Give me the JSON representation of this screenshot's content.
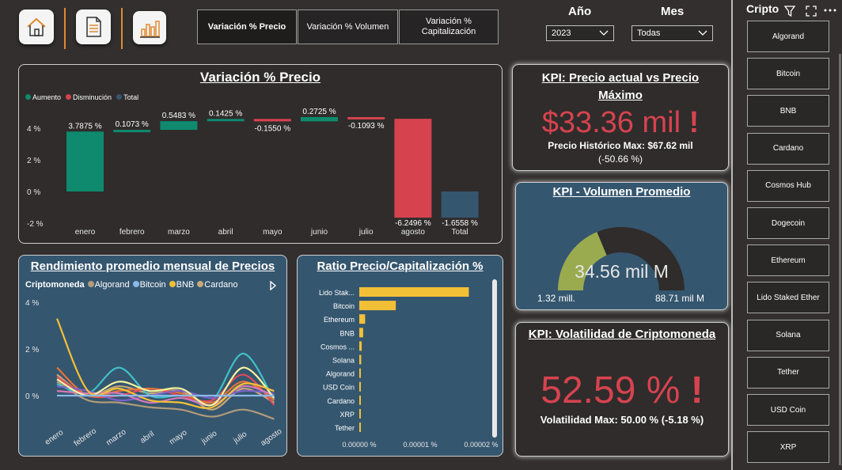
{
  "nav": {
    "home_icon": "home-icon",
    "report_icon": "document-icon",
    "chart_icon": "bar-chart-icon",
    "tabs": [
      {
        "label": "Variación % Precio"
      },
      {
        "label": "Variación % Volumen"
      },
      {
        "label": "Variación % Capitalización"
      }
    ]
  },
  "filters": {
    "year_label": "Año",
    "year_value": "2023",
    "month_label": "Mes",
    "month_value": "Todas"
  },
  "waterfall": {
    "title": "Variación % Precio",
    "legend": [
      {
        "label": "Aumento",
        "color": "#0f8a6e"
      },
      {
        "label": "Disminución",
        "color": "#d6434f"
      },
      {
        "label": "Total",
        "color": "#35566f"
      }
    ],
    "yticks": [
      "4 %",
      "2 %",
      "0 %",
      "-2 %"
    ]
  },
  "kpi_price": {
    "title_line1": "KPI: Precio actual vs Precio",
    "title_line2": "Máximo",
    "value": "$33.36 mil",
    "alert": "!",
    "sub1": "Precio Histórico Max: $67.62 mil",
    "sub2": "(-50.66 %)"
  },
  "kpi_volume": {
    "title": "KPI - Volumen Promedio",
    "value": "34.56 mil M",
    "min": "1.32 mill.",
    "max": "88.71 mil M",
    "fill_fraction": 0.375
  },
  "kpi_volatility": {
    "title": "KPI: Volatilidad de Criptomoneda",
    "value": "52.59 %",
    "alert": "!",
    "sub": "Volatilidad Max: 50.00 % (-5.18 %)"
  },
  "line_panel": {
    "title": "Rendimiento promedio mensual de Precios",
    "legend_title": "Criptomoneda",
    "legend": [
      {
        "label": "Algorand",
        "color": "#b39b7a"
      },
      {
        "label": "Bitcoin",
        "color": "#8ab8e8"
      },
      {
        "label": "BNB",
        "color": "#f2c037"
      },
      {
        "label": "Cardano",
        "color": "#c9a879"
      }
    ],
    "yticks": [
      "4 %",
      "2 %",
      "0 %"
    ],
    "xticks": [
      "enero",
      "febrero",
      "marzo",
      "abril",
      "mayo",
      "junio",
      "julio",
      "agosto"
    ]
  },
  "ratio_panel": {
    "title": "Ratio Precio/Capitalización %",
    "xticks": [
      "0.00000 %",
      "0.00001 %",
      "0.00002 %"
    ]
  },
  "slicer": {
    "title": "Cripto",
    "items": [
      "Algorand",
      "Bitcoin",
      "BNB",
      "Cardano",
      "Cosmos Hub",
      "Dogecoin",
      "Ethereum",
      "Lido Staked Ether",
      "Solana",
      "Tether",
      "USD Coin",
      "XRP"
    ]
  },
  "chart_data": [
    {
      "type": "bar",
      "title": "Variación % Precio",
      "subtype": "waterfall",
      "categories": [
        "enero",
        "febrero",
        "marzo",
        "abril",
        "mayo",
        "junio",
        "julio",
        "agosto",
        "Total"
      ],
      "values": [
        3.7875,
        0.1073,
        0.5483,
        0.1425,
        -0.155,
        0.2725,
        -0.1093,
        -6.2496,
        -1.6558
      ],
      "labels": [
        "3.7875 %",
        "0.1073 %",
        "0.5483 %",
        "0.1425 %",
        "-0.1550 %",
        "0.2725 %",
        "-0.1093 %",
        "-6.2496 %",
        "-1.6558 %"
      ],
      "ylim": [
        -2.4,
        4.6
      ],
      "series_legend": [
        "Aumento",
        "Disminución",
        "Total"
      ]
    },
    {
      "type": "bar",
      "title": "Ratio Precio/Capitalización %",
      "orientation": "horizontal",
      "categories": [
        "Lido Stak...",
        "Bitcoin",
        "Ethereum",
        "BNB",
        "Cosmos ...",
        "Solana",
        "Algorand",
        "USD Coin",
        "Cardano",
        "XRP",
        "Tether"
      ],
      "values": [
        2.25e-05,
        7.5e-06,
        1.2e-06,
        8e-07,
        5e-07,
        4e-07,
        2e-07,
        2e-07,
        1e-07,
        1e-07,
        1e-07
      ],
      "xlim": [
        0,
        2.6e-05
      ],
      "color": "#f2c037"
    },
    {
      "type": "line",
      "title": "Rendimiento promedio mensual de Precios",
      "categories": [
        "enero",
        "febrero",
        "marzo",
        "abril",
        "mayo",
        "junio",
        "julio",
        "agosto"
      ],
      "ylim": [
        -1.5,
        4
      ],
      "series": [
        {
          "name": "Algorand",
          "color": "#b39b7a",
          "values": [
            0.6,
            -0.2,
            -0.3,
            -0.5,
            -0.6,
            -0.9,
            -0.6,
            -1.0
          ]
        },
        {
          "name": "Bitcoin",
          "color": "#8ab8e8",
          "values": [
            0.0,
            0.0,
            0.0,
            0.0,
            0.0,
            0.0,
            0.0,
            0.0
          ]
        },
        {
          "name": "BNB",
          "color": "#f2c037",
          "values": [
            3.3,
            0.2,
            0.3,
            -0.2,
            -0.3,
            -0.5,
            0.5,
            0.2
          ]
        },
        {
          "name": "Cardano",
          "color": "#c9a879",
          "values": [
            0.9,
            0.0,
            0.4,
            0.1,
            0.2,
            -0.6,
            0.3,
            -0.3
          ]
        },
        {
          "values": [
            0.5,
            0.1,
            1.2,
            0.0,
            0.0,
            -0.2,
            1.8,
            -0.2
          ],
          "color": "#3fc1c9"
        },
        {
          "values": [
            0.8,
            0.0,
            0.0,
            0.3,
            0.0,
            -0.2,
            0.9,
            -0.4
          ],
          "color": "#e24a5a"
        },
        {
          "values": [
            1.2,
            0.0,
            0.2,
            0.3,
            0.1,
            -0.3,
            0.6,
            -0.2
          ],
          "color": "#e8733a"
        },
        {
          "values": [
            0.4,
            0.2,
            -0.2,
            0.0,
            0.2,
            -0.1,
            0.2,
            0.1
          ],
          "color": "#7b62c9"
        },
        {
          "values": [
            0.2,
            0.1,
            0.1,
            -0.3,
            -0.1,
            -0.4,
            0.4,
            0.0
          ],
          "color": "#d67ab8"
        },
        {
          "values": [
            0.7,
            0.0,
            0.6,
            0.2,
            0.3,
            -0.4,
            1.2,
            -0.1
          ],
          "color": "#f4f4a0"
        }
      ]
    }
  ]
}
